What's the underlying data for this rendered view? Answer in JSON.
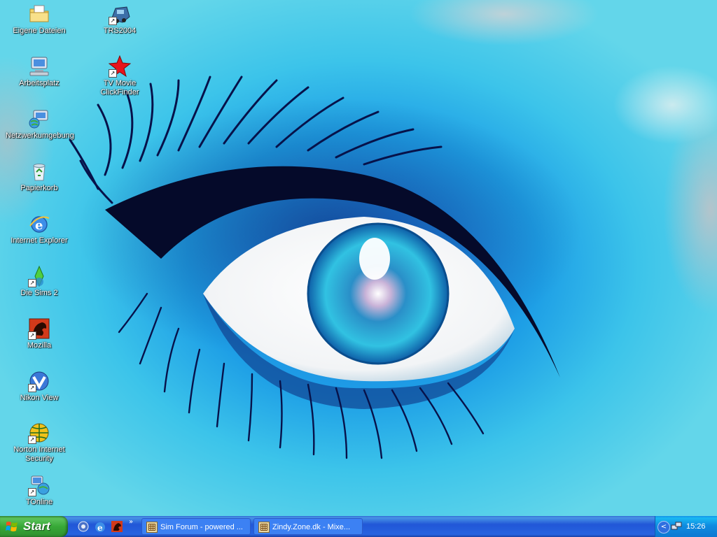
{
  "desktop": {
    "icons": [
      {
        "label": "Eigene Dateien",
        "icon": "my-documents-folder-icon",
        "shortcut": false
      },
      {
        "label": "Arbeitsplatz",
        "icon": "my-computer-icon",
        "shortcut": false
      },
      {
        "label": "Netzwerkumgebung",
        "icon": "network-places-icon",
        "shortcut": false
      },
      {
        "label": "Papierkorb",
        "icon": "recycle-bin-icon",
        "shortcut": false
      },
      {
        "label": "Internet Explorer",
        "icon": "internet-explorer-icon",
        "shortcut": false
      },
      {
        "label": "Die Sims 2",
        "icon": "sims-plumbob-icon",
        "shortcut": true
      },
      {
        "label": "Mozilla",
        "icon": "mozilla-dino-icon",
        "shortcut": true
      },
      {
        "label": "Nikon View",
        "icon": "nikon-view-icon",
        "shortcut": true
      },
      {
        "label": "Norton Internet Security",
        "icon": "norton-globe-icon",
        "shortcut": true
      },
      {
        "label": "TOnline",
        "icon": "tonline-icon",
        "shortcut": true
      },
      {
        "label": "TRS2004",
        "icon": "trs2004-train-icon",
        "shortcut": true
      },
      {
        "label": "TV Movie ClickFinder",
        "icon": "tv-movie-star-icon",
        "shortcut": true
      }
    ],
    "wallpaper": "blue-eye-wallpaper"
  },
  "taskbar": {
    "start_label": "Start",
    "quick_launch": [
      "mozilla-quicklaunch-icon",
      "internet-explorer-quicklaunch-icon",
      "mozilla-dino-quicklaunch-icon"
    ],
    "quick_launch_more": "»",
    "tasks": [
      {
        "label": "Sim Forum - powered ...",
        "icon": "forum-window-icon"
      },
      {
        "label": "Zindy.Zone.dk - Mixe...",
        "icon": "forum-window-icon"
      }
    ],
    "tray": {
      "expand": "<",
      "clock": "15:26"
    }
  },
  "colors": {
    "taskbar_blue": "#2157d7",
    "start_green": "#37a937",
    "tray_blue": "#0f8ce0"
  }
}
